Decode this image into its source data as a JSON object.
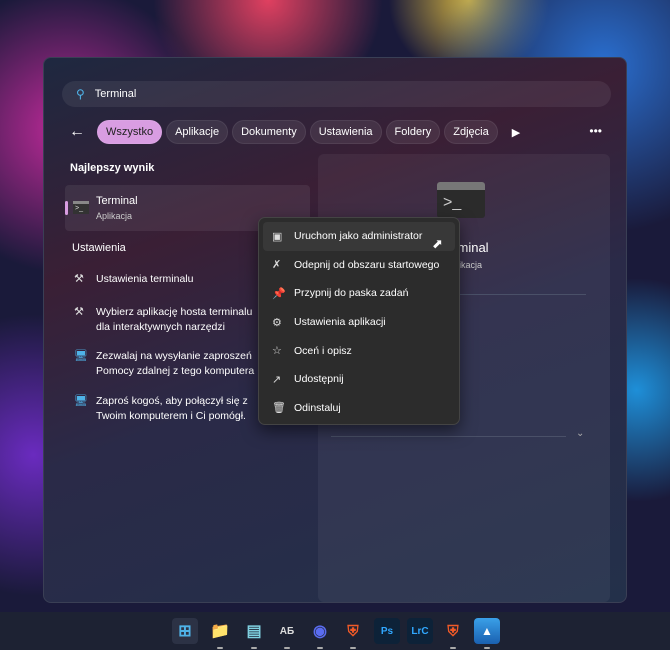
{
  "search": {
    "value": "Terminal"
  },
  "filters": [
    "Wszystko",
    "Aplikacje",
    "Dokumenty",
    "Ustawienia",
    "Foldery",
    "Zdjęcia"
  ],
  "sections": {
    "best": "Najlepszy wynik",
    "settings": "Ustawienia"
  },
  "best_result": {
    "title": "Terminal",
    "subtitle": "Aplikacja"
  },
  "settings_items": [
    {
      "line1": "Ustawienia terminalu",
      "line2": ""
    },
    {
      "line1": "Wybierz aplikację hosta terminalu",
      "line2": "dla interaktywnych narzędzi"
    },
    {
      "line1": "Zezwalaj na wysyłanie zaproszeń",
      "line2": "Pomocy zdalnej z tego komputera"
    },
    {
      "line1": "Zaproś kogoś, aby połączył się z",
      "line2": "Twoim komputerem i Ci pomógł."
    }
  ],
  "preview": {
    "title": "Terminal",
    "subtitle": "Aplikacja"
  },
  "context_menu": [
    "Uruchom jako administrator",
    "Odepnij od obszaru startowego",
    "Przypnij do paska zadań",
    "Ustawienia aplikacji",
    "Oceń i opisz",
    "Udostępnij",
    "Odinstaluj"
  ],
  "taskbar": {
    "ps": "Ps",
    "lrc": "LrC"
  }
}
